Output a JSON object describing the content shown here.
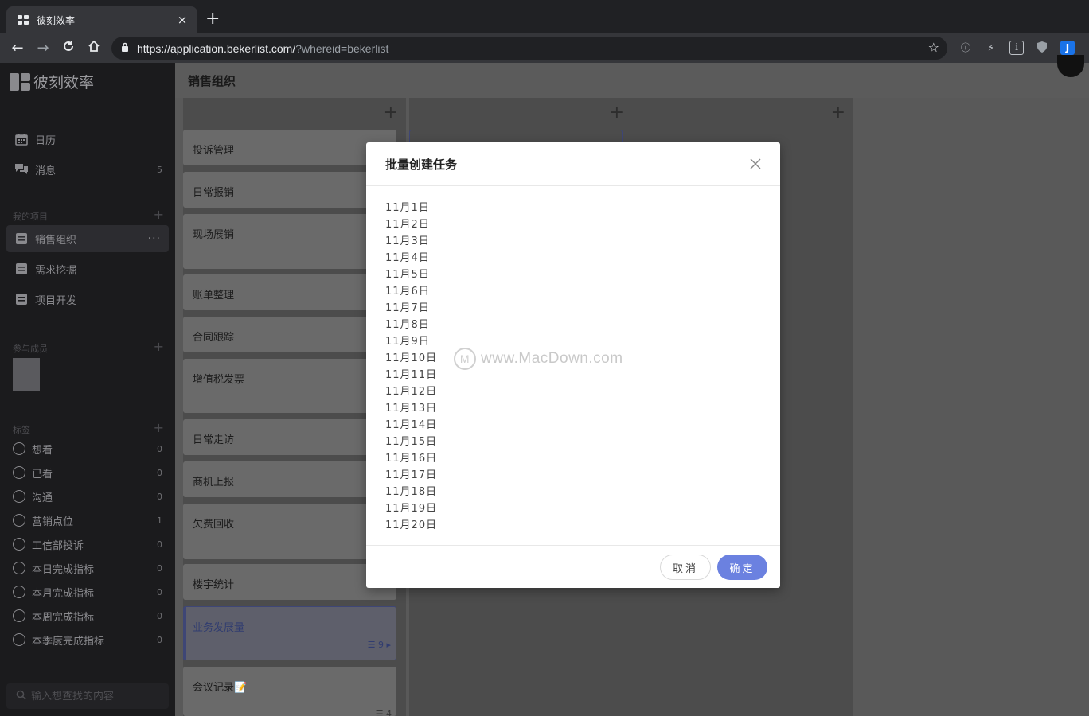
{
  "browser": {
    "tab_title": "彼刻效率",
    "tab_close": "×",
    "new_tab": "+",
    "url_main": "https://application.bekerlist.com/",
    "url_query": "?whereid=bekerlist",
    "ext_j": "J",
    "ext_i": "i"
  },
  "sidebar": {
    "logo": "彼刻效率",
    "calendar": "日历",
    "messages": "消息",
    "messages_count": "5",
    "my_projects_header": "我的项目",
    "projects": [
      {
        "label": "销售组织"
      },
      {
        "label": "需求挖掘"
      },
      {
        "label": "项目开发"
      }
    ],
    "project_more": "···",
    "members_header": "参与成员",
    "tags_header": "标签",
    "tags": [
      {
        "label": "想看",
        "count": "0"
      },
      {
        "label": "已看",
        "count": "0"
      },
      {
        "label": "沟通",
        "count": "0"
      },
      {
        "label": "营销点位",
        "count": "1"
      },
      {
        "label": "工信部投诉",
        "count": "0"
      },
      {
        "label": "本日完成指标",
        "count": "0"
      },
      {
        "label": "本月完成指标",
        "count": "0"
      },
      {
        "label": "本周完成指标",
        "count": "0"
      },
      {
        "label": "本季度完成指标",
        "count": "0"
      }
    ],
    "search_placeholder": "输入想查找的内容"
  },
  "header": {
    "title": "销售组织"
  },
  "board": {
    "cards": [
      {
        "label": "投诉管理"
      },
      {
        "label": "日常报销"
      },
      {
        "label": "现场展销"
      },
      {
        "label": "账单整理"
      },
      {
        "label": "合同跟踪"
      },
      {
        "label": "增值税发票"
      },
      {
        "label": "日常走访"
      },
      {
        "label": "商机上报"
      },
      {
        "label": "欠费回收"
      },
      {
        "label": "楼宇统计"
      },
      {
        "label": "业务发展量",
        "meta": "☰ 9 ▸"
      },
      {
        "label": "会议记录📝",
        "meta": "☰ 4"
      }
    ]
  },
  "modal": {
    "title": "批量创建任务",
    "lines": [
      "11月1日",
      "11月2日",
      "11月3日",
      "11月4日",
      "11月5日",
      "11月6日",
      "11月7日",
      "11月8日",
      "11月9日",
      "11月10日",
      "11月11日",
      "11月12日",
      "11月13日",
      "11月14日",
      "11月15日",
      "11月16日",
      "11月17日",
      "11月18日",
      "11月19日",
      "11月20日"
    ],
    "cancel_label": "取消",
    "ok_label": "确定"
  },
  "watermark": "www.MacDown.com"
}
